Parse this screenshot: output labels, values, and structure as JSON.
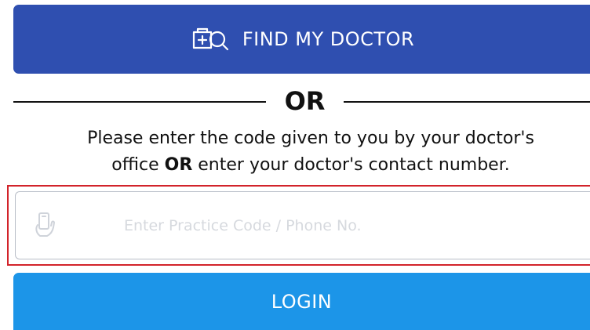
{
  "find_button": {
    "label": "FIND MY DOCTOR",
    "icon": "medical-search-icon",
    "color": "#2f4fb0"
  },
  "divider": {
    "text": "OR"
  },
  "instructions": {
    "part1": "Please enter the code given to you by your doctor's",
    "part2": "office ",
    "emphasis": "OR",
    "part3": " enter your doctor's contact number."
  },
  "code_field": {
    "placeholder": "Enter Practice Code / Phone No.",
    "value": "",
    "icon": "hand-phone-icon",
    "highlight_color": "#d2232a"
  },
  "login_button": {
    "label": "LOGIN",
    "color": "#1c95e8"
  }
}
